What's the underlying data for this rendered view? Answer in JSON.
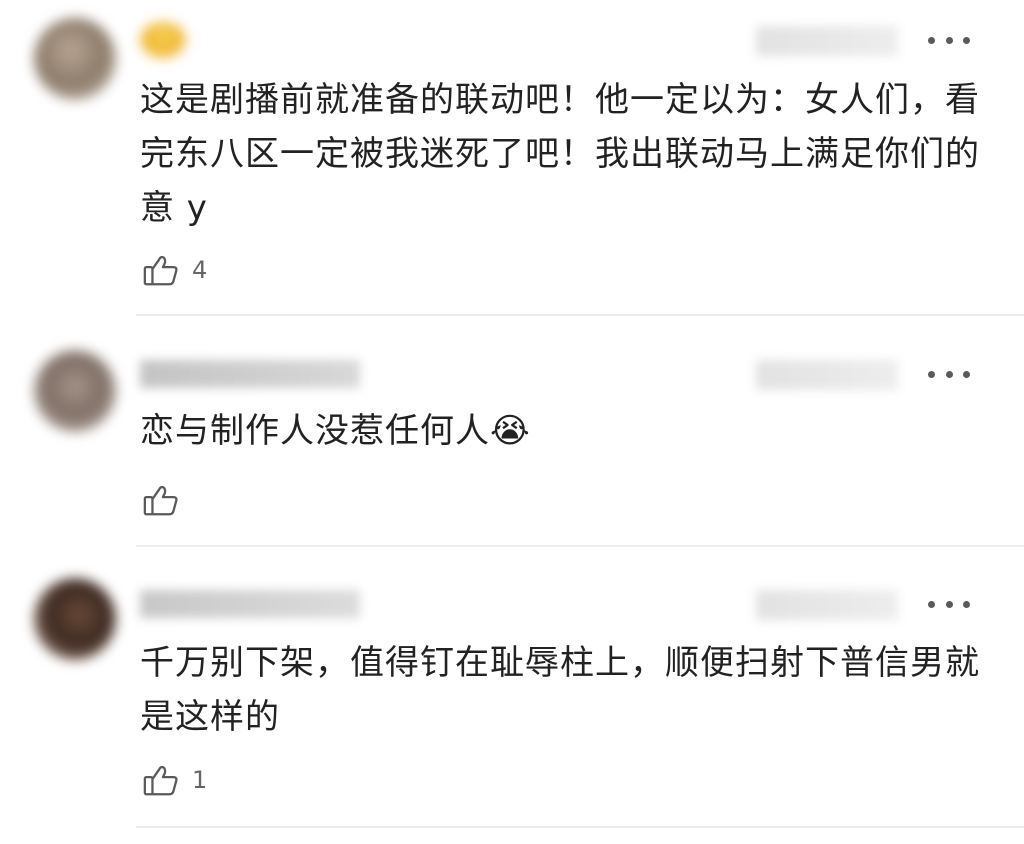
{
  "comments": [
    {
      "username": "",
      "timestamp": "",
      "content": "这是剧播前就准备的联动吧！他一定以为：女人们，看完东八区一定被我迷死了吧！我出联动马上满足你们的意 y",
      "likes": "4"
    },
    {
      "username": "",
      "timestamp": "",
      "content": "恋与制作人没惹任何人😭",
      "likes": ""
    },
    {
      "username": "",
      "timestamp": "",
      "content": "千万别下架，值得钉在耻辱柱上，顺便扫射下普信男就是这样的",
      "likes": "1"
    }
  ],
  "icons": {
    "more": "more-icon",
    "like": "thumbs-up-icon"
  },
  "colors": {
    "text": "#222222",
    "meta": "#666666",
    "divider": "#ececec"
  }
}
